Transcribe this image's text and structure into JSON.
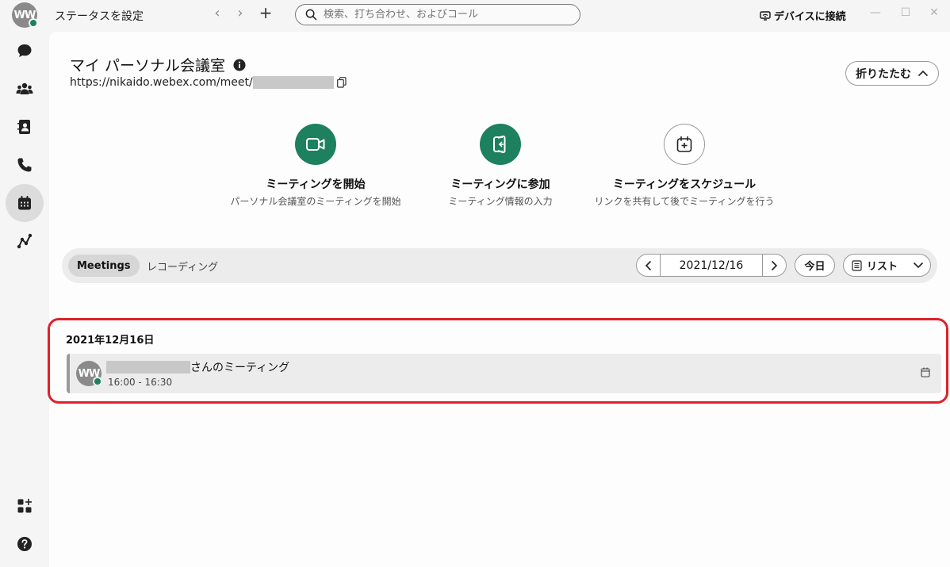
{
  "titlebar": {
    "avatar_initials": "WW",
    "status_label": "ステータスを設定",
    "search_placeholder": "検索、打ち合わせ、およびコール",
    "device_label": "デバイスに接続"
  },
  "rail": {
    "items": [
      {
        "name": "messaging",
        "icon": "chat-bubble-icon"
      },
      {
        "name": "teams",
        "icon": "people-icon"
      },
      {
        "name": "contacts",
        "icon": "contacts-icon"
      },
      {
        "name": "calling",
        "icon": "phone-icon"
      },
      {
        "name": "meetings",
        "icon": "calendar-icon",
        "active": true
      },
      {
        "name": "connections",
        "icon": "graph-icon"
      }
    ],
    "bottom": [
      {
        "name": "apps",
        "icon": "apps-icon"
      },
      {
        "name": "help",
        "icon": "help-icon"
      }
    ]
  },
  "room": {
    "title": "マイ パーソナル会議室",
    "url_prefix": "https://nikaido.webex.com/meet/",
    "collapse_label": "折りたたむ"
  },
  "actions": [
    {
      "title": "ミーティングを開始",
      "subtitle": "パーソナル会議室のミーティングを開始"
    },
    {
      "title": "ミーティングに参加",
      "subtitle": "ミーティング情報の入力"
    },
    {
      "title": "ミーティングをスケジュール",
      "subtitle": "リンクを共有して後でミーティングを行う"
    }
  ],
  "tabs": {
    "meetings": "Meetings",
    "recordings": "レコーディング"
  },
  "date_nav": {
    "date": "2021/12/16",
    "today_label": "今日",
    "view_label": "リスト"
  },
  "schedule": {
    "day_header": "2021年12月16日",
    "meeting": {
      "avatar_initials": "WW",
      "title_suffix": "さんのミーティング",
      "time": "16:00 - 16:30"
    }
  },
  "colors": {
    "accent_green": "#1d805f",
    "highlight_red": "#e0202a"
  }
}
